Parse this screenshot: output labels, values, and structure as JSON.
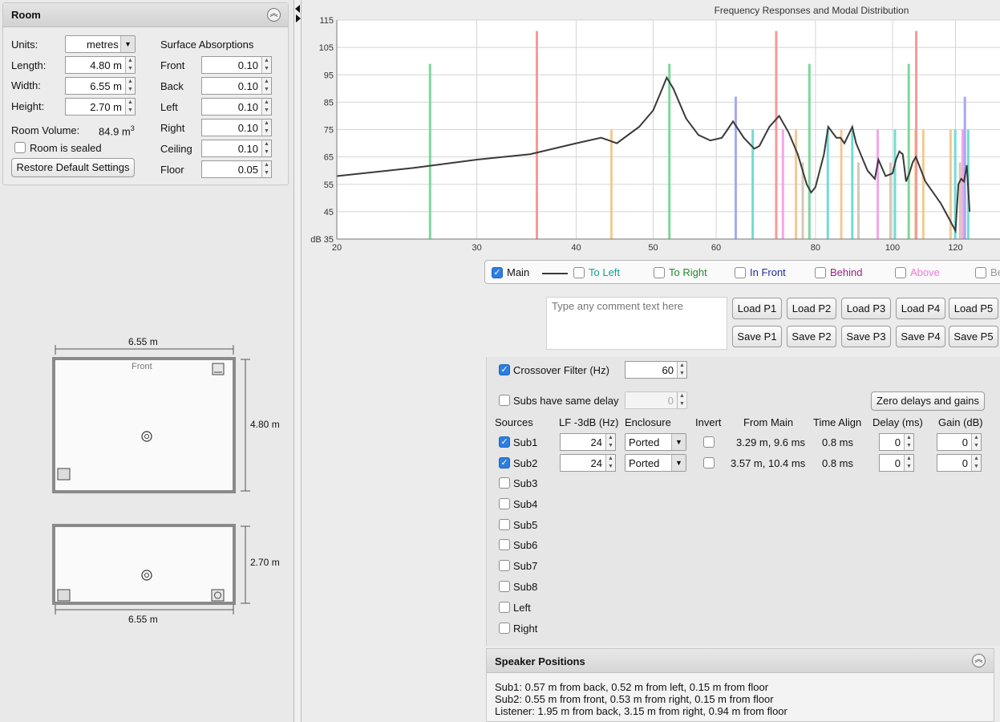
{
  "room": {
    "title": "Room",
    "units_label": "Units:",
    "units_value": "metres",
    "length_label": "Length:",
    "length_value": "4.80 m",
    "width_label": "Width:",
    "width_value": "6.55 m",
    "height_label": "Height:",
    "height_value": "2.70 m",
    "volume_label": "Room Volume:",
    "volume_value": "84.9 m",
    "volume_exp": "3",
    "sealed_label": "Room is sealed",
    "restore_label": "Restore Default Settings",
    "absorption_title": "Surface Absorptions",
    "surfaces": [
      {
        "label": "Front",
        "value": "0.10"
      },
      {
        "label": "Back",
        "value": "0.10"
      },
      {
        "label": "Left",
        "value": "0.10"
      },
      {
        "label": "Right",
        "value": "0.10"
      },
      {
        "label": "Ceiling",
        "value": "0.10"
      },
      {
        "label": "Floor",
        "value": "0.05"
      }
    ]
  },
  "plan": {
    "top_width": "6.55 m",
    "front_label": "Front",
    "depth": "4.80 m",
    "side_height": "2.70 m",
    "bottom_width": "6.55 m"
  },
  "chart": {
    "title": "Frequency Responses and Modal Distribution",
    "y_unit": "dB",
    "main_color": "#3a3a3a"
  },
  "chart_data": {
    "type": "line",
    "title": "Frequency Responses and Modal Distribution",
    "x_scale": "log",
    "xlim": [
      20,
      125
    ],
    "ylim": [
      35,
      115
    ],
    "x_ticks": [
      20,
      30,
      40,
      50,
      60,
      80,
      100,
      120
    ],
    "y_ticks": [
      35,
      45,
      55,
      65,
      75,
      85,
      95,
      105,
      115
    ],
    "ylabel": "dB",
    "grid": true,
    "series": [
      {
        "name": "Main",
        "x": [
          20,
          25,
          30,
          35,
          40,
          43,
          44,
          45,
          48,
          50,
          51,
          52,
          53,
          55,
          57,
          59,
          61,
          62,
          63,
          65,
          67,
          68,
          70,
          72,
          74,
          76,
          78,
          79,
          80,
          82,
          83,
          85,
          86,
          87,
          89,
          90,
          93,
          95,
          96,
          98,
          100,
          101,
          102,
          103,
          104,
          105,
          106,
          107,
          108,
          110,
          115,
          118,
          120,
          121,
          122,
          123,
          124,
          125
        ],
        "values": [
          58,
          61,
          64,
          66,
          70,
          72,
          71,
          70,
          76,
          82,
          88,
          94,
          90,
          79,
          73,
          71,
          72,
          75,
          78,
          72,
          68,
          69,
          76,
          80,
          74,
          66,
          55,
          52,
          54,
          66,
          76,
          72,
          72,
          70,
          76,
          70,
          60,
          57,
          64,
          58,
          59,
          64,
          67,
          66,
          56,
          59,
          63,
          65,
          62,
          56,
          48,
          42,
          38,
          55,
          57,
          56,
          62,
          45
        ]
      }
    ],
    "modes": [
      {
        "f": 26.2,
        "level": 99,
        "color": "#7dd89a"
      },
      {
        "f": 35.7,
        "level": 111,
        "color": "#f59a9a"
      },
      {
        "f": 44.3,
        "level": 75,
        "color": "#f3c98f"
      },
      {
        "f": 52.4,
        "level": 99,
        "color": "#7dd89a"
      },
      {
        "f": 63.5,
        "level": 87,
        "color": "#a8a8f0"
      },
      {
        "f": 66.7,
        "level": 75,
        "color": "#72dcd3"
      },
      {
        "f": 71.4,
        "level": 111,
        "color": "#f59a9a"
      },
      {
        "f": 72.8,
        "level": 75,
        "color": "#f5a6e9"
      },
      {
        "f": 75.6,
        "level": 75,
        "color": "#f3c98f"
      },
      {
        "f": 77.1,
        "level": 63,
        "color": "#d6c7b8"
      },
      {
        "f": 78.6,
        "level": 99,
        "color": "#7dd89a"
      },
      {
        "f": 82.9,
        "level": 75,
        "color": "#72dcd3"
      },
      {
        "f": 86.2,
        "level": 75,
        "color": "#f3c98f"
      },
      {
        "f": 89.0,
        "level": 75,
        "color": "#72dcd3"
      },
      {
        "f": 90.6,
        "level": 63,
        "color": "#d6c7b8"
      },
      {
        "f": 95.8,
        "level": 75,
        "color": "#f5a6e9"
      },
      {
        "f": 99.4,
        "level": 63,
        "color": "#d6c7b8"
      },
      {
        "f": 100.7,
        "level": 75,
        "color": "#72dcd3"
      },
      {
        "f": 104.8,
        "level": 99,
        "color": "#7dd89a"
      },
      {
        "f": 106.9,
        "level": 75,
        "color": "#f3c98f"
      },
      {
        "f": 107.1,
        "level": 111,
        "color": "#f59a9a"
      },
      {
        "f": 109.3,
        "level": 75,
        "color": "#f3c98f"
      },
      {
        "f": 118.3,
        "level": 75,
        "color": "#f3c98f"
      },
      {
        "f": 119.9,
        "level": 75,
        "color": "#72dcd3"
      },
      {
        "f": 121.6,
        "level": 63,
        "color": "#d6c7b8"
      },
      {
        "f": 122.5,
        "level": 75,
        "color": "#f5a6e9"
      },
      {
        "f": 123.3,
        "level": 87,
        "color": "#a8a8f0"
      },
      {
        "f": 124.5,
        "level": 75,
        "color": "#72dcd3"
      }
    ]
  },
  "legend": [
    {
      "label": "Main",
      "checked": true,
      "color": "#111111"
    },
    {
      "label": "To Left",
      "checked": false,
      "color": "#10a39a"
    },
    {
      "label": "To Right",
      "checked": false,
      "color": "#1e8a2c"
    },
    {
      "label": "In Front",
      "checked": false,
      "color": "#1f2ea0"
    },
    {
      "label": "Behind",
      "checked": false,
      "color": "#9c1f86"
    },
    {
      "label": "Above",
      "checked": false,
      "color": "#ef7ad8"
    },
    {
      "label": "Be",
      "checked": false,
      "color": "#999999"
    }
  ],
  "comment": {
    "placeholder": "Type any comment text here"
  },
  "presets": {
    "load": [
      "Load P1",
      "Load P2",
      "Load P3",
      "Load P4",
      "Load P5"
    ],
    "save": [
      "Save P1",
      "Save P2",
      "Save P3",
      "Save P4",
      "Save P5"
    ]
  },
  "subs": {
    "crossover_label": "Crossover Filter (Hz)",
    "crossover_value": "60",
    "same_delay_label": "Subs have same delay",
    "same_delay_value": "0",
    "zero_button": "Zero delays and gains",
    "headers": [
      "Sources",
      "LF -3dB (Hz)",
      "Enclosure",
      "Invert",
      "From Main",
      "Time Align",
      "Delay (ms)",
      "Gain (dB)"
    ],
    "active": [
      {
        "name": "Sub1",
        "lf": "24",
        "enclosure": "Ported",
        "from_main": "3.29 m, 9.6 ms",
        "time_align": "0.8 ms",
        "delay": "0",
        "gain": "0"
      },
      {
        "name": "Sub2",
        "lf": "24",
        "enclosure": "Ported",
        "from_main": "3.57 m, 10.4 ms",
        "time_align": "0.8 ms",
        "delay": "0",
        "gain": "0"
      }
    ],
    "inactive": [
      "Sub3",
      "Sub4",
      "Sub5",
      "Sub6",
      "Sub7",
      "Sub8",
      "Left",
      "Right"
    ]
  },
  "positions": {
    "title": "Speaker Positions",
    "lines": [
      "Sub1: 0.57 m from back, 0.52 m from left, 0.15 m from floor",
      "Sub2: 0.55 m from front, 0.53 m from right, 0.15 m from floor",
      "Listener: 1.95 m from back, 3.15 m from right, 0.94 m from floor"
    ]
  }
}
